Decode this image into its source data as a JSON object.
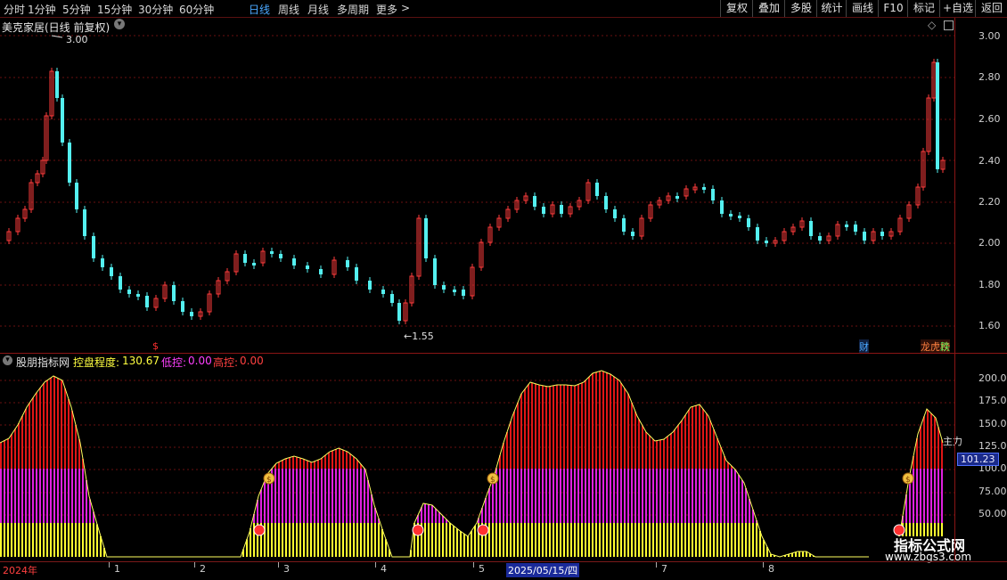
{
  "toolbar": {
    "periods": [
      "分时",
      "1分钟",
      "5分钟",
      "15分钟",
      "30分钟",
      "60分钟",
      "日线",
      "周线",
      "月线",
      "多周期",
      "更多"
    ],
    "active_period": "日线",
    "more_arrow": ">",
    "right_buttons": [
      "复权",
      "叠加",
      "多股",
      "统计",
      "画线",
      "F10",
      "标记",
      "+自选",
      "返回"
    ]
  },
  "price_panel": {
    "title": "美克家居(日线 前复权)",
    "high_marker": "3.00",
    "low_marker": "←1.55",
    "y_ticks": [
      "3.00",
      "2.80",
      "2.60",
      "2.40",
      "2.20",
      "2.00",
      "1.80",
      "1.60"
    ],
    "badge_cai": "财",
    "badge_longhu": "龙虎榜",
    "badge_die": "跌",
    "dollar_marker": "$"
  },
  "indicator_panel": {
    "name": "股朋指标网",
    "label1": "控盘程度:",
    "value1": "130.67",
    "label2": "低控:",
    "value2": "0.00",
    "label3": "高控:",
    "value3": "0.00",
    "y_ticks": [
      "200.0",
      "175.0",
      "150.0",
      "125.0",
      "100.0",
      "75.00",
      "50.00"
    ],
    "current_value": "101.23",
    "edge_label": "主力"
  },
  "time_axis": {
    "labels": [
      "2024年",
      "1",
      "2",
      "3",
      "4",
      "5",
      "2025/05/15/四",
      "7",
      "8"
    ]
  },
  "watermark": {
    "line1": "指标公式网",
    "line2": "www.zbgs3.com"
  },
  "colors": {
    "up": "#ff3c3c",
    "down": "#54f0f0",
    "high_zone": "#e01616",
    "mid_zone": "#e020e0",
    "low_zone": "#ffff30",
    "outline": "#ffff60",
    "active": "#4aa8ff"
  },
  "icons": [
    "chevron-down-icon",
    "diamond-icon",
    "window-icon",
    "money-bag-icon",
    "ball-icon"
  ]
}
